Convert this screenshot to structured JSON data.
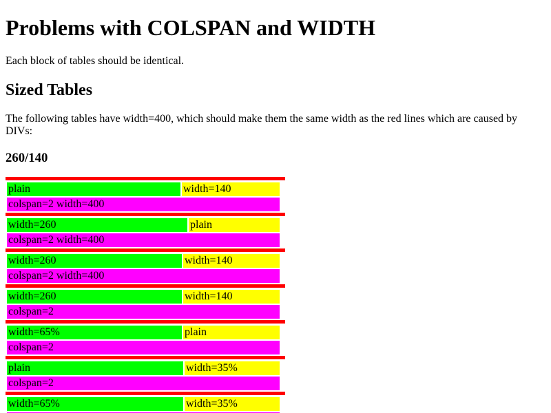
{
  "page": {
    "title": "Problems with COLSPAN and WIDTH",
    "intro": "Each block of tables should be identical.",
    "section_title": "Sized Tables",
    "section_text": "The following tables have width=400, which should make them the same width as the red lines which are caused by DIVs:",
    "subsection_title": "260/140"
  },
  "colors": {
    "divider": "#ff0000",
    "cell_left": "#00ff00",
    "cell_right": "#ffff00",
    "cell_span": "#ff00ff"
  },
  "tables": [
    {
      "left": "plain",
      "right": "width=140",
      "span": "colspan=2 width=400"
    },
    {
      "left": "width=260",
      "right": "plain",
      "span": "colspan=2 width=400"
    },
    {
      "left": "width=260",
      "right": "width=140",
      "span": "colspan=2 width=400"
    },
    {
      "left": "width=260",
      "right": "width=140",
      "span": "colspan=2"
    },
    {
      "left": "width=65%",
      "right": "plain",
      "span": "colspan=2"
    },
    {
      "left": "plain",
      "right": "width=35%",
      "span": "colspan=2"
    },
    {
      "left": "width=65%",
      "right": "width=35%"
    }
  ]
}
